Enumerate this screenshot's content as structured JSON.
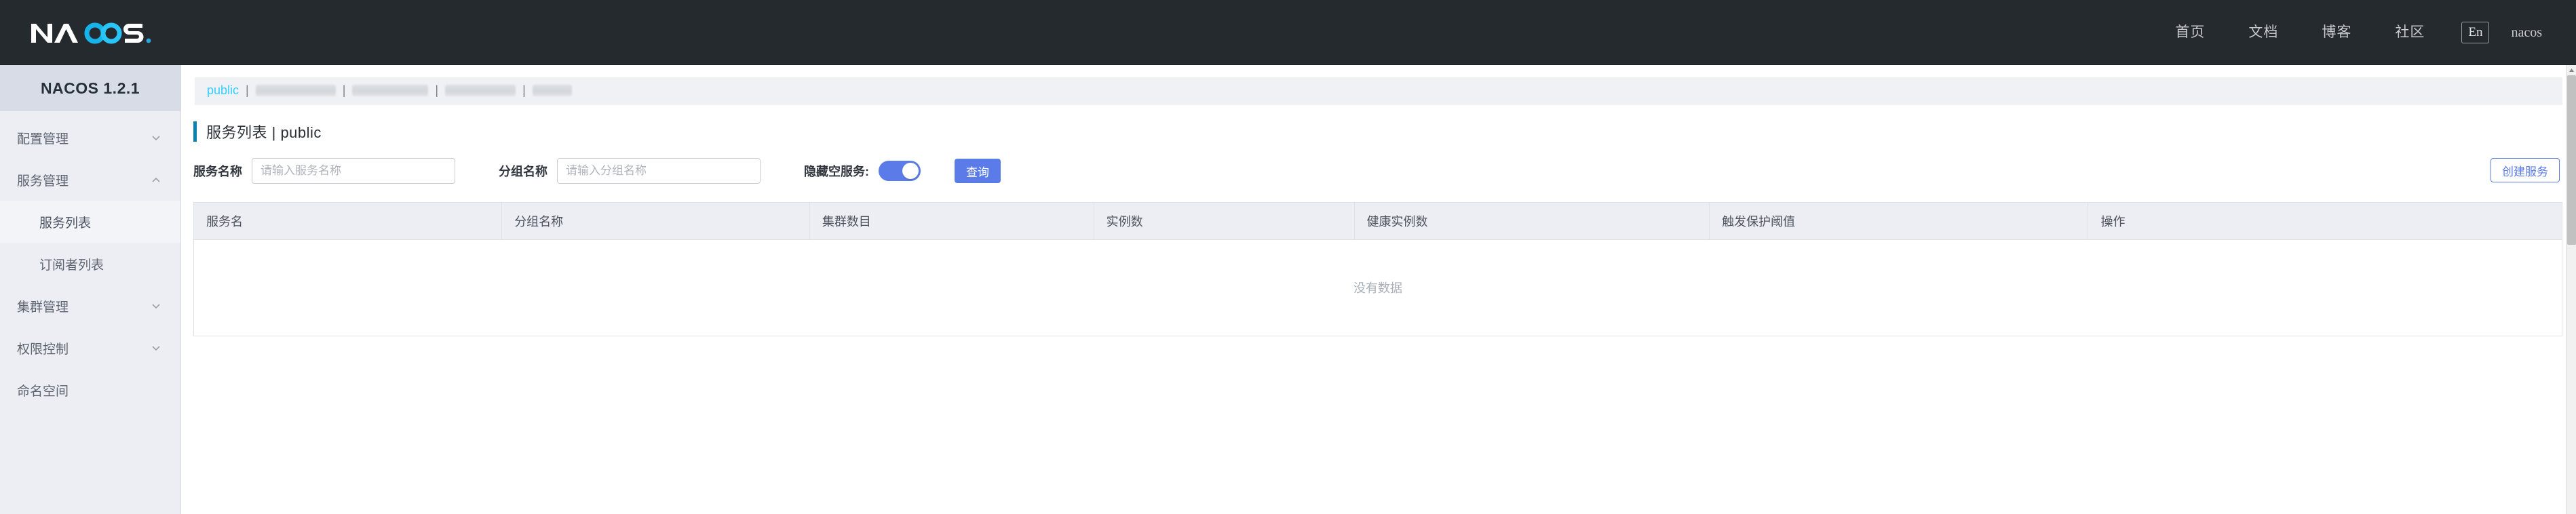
{
  "header": {
    "logo_text": "NACOS.",
    "logo_alt": "nacos-logo",
    "nav": [
      {
        "label": "首页",
        "name": "nav-home"
      },
      {
        "label": "文档",
        "name": "nav-docs"
      },
      {
        "label": "博客",
        "name": "nav-blog"
      },
      {
        "label": "社区",
        "name": "nav-community"
      }
    ],
    "lang_button": "En",
    "user": "nacos",
    "bg_color": "#252a2f"
  },
  "sidebar": {
    "product_version": "NACOS 1.2.1",
    "items": [
      {
        "label": "配置管理",
        "name": "sidebar-item-config-management",
        "expanded": false,
        "chevron": "chevron-down-icon"
      },
      {
        "label": "服务管理",
        "name": "sidebar-item-service-management",
        "expanded": true,
        "chevron": "chevron-up-icon"
      },
      {
        "label": "集群管理",
        "name": "sidebar-item-cluster-management",
        "expanded": false,
        "chevron": "chevron-down-icon"
      },
      {
        "label": "权限控制",
        "name": "sidebar-item-permission-control",
        "expanded": false,
        "chevron": "chevron-down-icon"
      },
      {
        "label": "命名空间",
        "name": "sidebar-item-namespace",
        "expanded": false,
        "chevron": "none"
      }
    ],
    "sub_items": [
      {
        "label": "服务列表",
        "name": "sidebar-subitem-service-list",
        "active": true
      },
      {
        "label": "订阅者列表",
        "name": "sidebar-subitem-subscriber-list",
        "active": false
      }
    ]
  },
  "namespace_bar": {
    "active": "public",
    "redacted_widths": [
      58,
      56,
      52,
      30
    ],
    "separator": "|"
  },
  "page": {
    "title": "服务列表  |  public",
    "accent_color": "#0b83b1"
  },
  "search": {
    "service_name_label": "服务名称",
    "service_name_value": "",
    "service_name_placeholder": "请输入服务名称",
    "group_name_label": "分组名称",
    "group_name_value": "",
    "group_name_placeholder": "请输入分组名称",
    "hide_empty_label": "隐藏空服务:",
    "hide_empty_on": true,
    "query_button": "查询",
    "create_button": "创建服务",
    "primary_color": "#5b7ce8"
  },
  "table": {
    "columns": [
      {
        "label": "服务名",
        "width": "13%"
      },
      {
        "label": "分组名称",
        "width": "13%"
      },
      {
        "label": "集群数目",
        "width": "12%"
      },
      {
        "label": "实例数",
        "width": "11%"
      },
      {
        "label": "健康实例数",
        "width": "15%"
      },
      {
        "label": "触发保护阈值",
        "width": "16%"
      },
      {
        "label": "操作",
        "width": "20%"
      }
    ],
    "rows": [],
    "empty_text": "没有数据"
  }
}
